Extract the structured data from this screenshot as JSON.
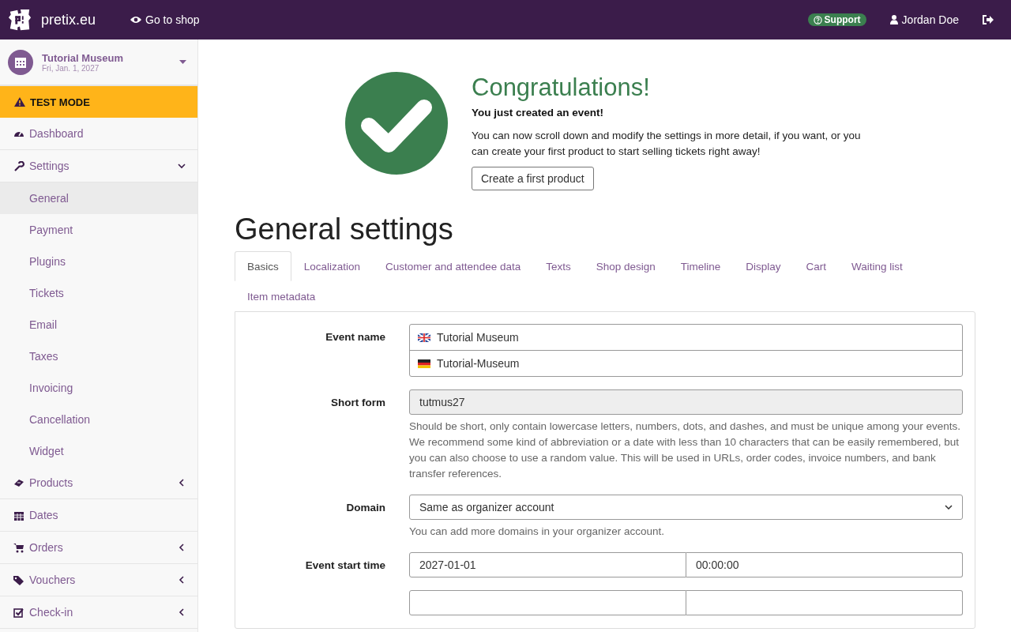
{
  "topbar": {
    "brand": "pretix.eu",
    "shop_link": "Go to shop",
    "support": "Support",
    "user": "Jordan Doe"
  },
  "sidebar": {
    "event": {
      "name": "Tutorial Museum",
      "date": "Fri, Jan. 1, 2027"
    },
    "test_mode": "TEST MODE",
    "items": [
      {
        "label": "Dashboard",
        "selected": false
      },
      {
        "label": "Settings",
        "selected": false,
        "expanded": true,
        "children": [
          {
            "label": "General",
            "selected": true
          },
          {
            "label": "Payment",
            "selected": false
          },
          {
            "label": "Plugins",
            "selected": false
          },
          {
            "label": "Tickets",
            "selected": false
          },
          {
            "label": "Email",
            "selected": false
          },
          {
            "label": "Taxes",
            "selected": false
          },
          {
            "label": "Invoicing",
            "selected": false
          },
          {
            "label": "Cancellation",
            "selected": false
          },
          {
            "label": "Widget",
            "selected": false
          }
        ]
      },
      {
        "label": "Products",
        "selected": false,
        "expanded": false
      },
      {
        "label": "Dates",
        "selected": false
      },
      {
        "label": "Orders",
        "selected": false,
        "expanded": false
      },
      {
        "label": "Vouchers",
        "selected": false,
        "expanded": false
      },
      {
        "label": "Check-in",
        "selected": false,
        "expanded": false
      }
    ]
  },
  "success": {
    "title": "Congratulations!",
    "subtitle": "You just created an event!",
    "text": "You can now scroll down and modify the settings in more detail, if you want, or you can create your first product to start selling tickets right away!",
    "button": "Create a first product"
  },
  "heading": "General settings",
  "tabs": [
    {
      "label": "Basics",
      "selected": true
    },
    {
      "label": "Localization",
      "selected": false
    },
    {
      "label": "Customer and attendee data",
      "selected": false
    },
    {
      "label": "Texts",
      "selected": false
    },
    {
      "label": "Shop design",
      "selected": false
    },
    {
      "label": "Timeline",
      "selected": false
    },
    {
      "label": "Display",
      "selected": false
    },
    {
      "label": "Cart",
      "selected": false
    },
    {
      "label": "Waiting list",
      "selected": false
    },
    {
      "label": "Item metadata",
      "selected": false
    }
  ],
  "fields": [
    {
      "kind": "i18n",
      "label": "Event name",
      "values": [
        "Tutorial Museum",
        "Tutorial-Museum"
      ]
    },
    {
      "kind": "text",
      "label": "Short form",
      "value": "tutmus27",
      "disabled": true,
      "help": "Should be short, only contain lowercase letters, numbers, dots, and dashes, and must be unique among your events. We recommend some kind of abbreviation or a date with less than 10 characters that can be easily remembered, but you can also choose to use a random value. This will be used in URLs, order codes, invoice numbers, and bank transfer references."
    },
    {
      "kind": "select",
      "label": "Domain",
      "value": "Same as organizer account",
      "help": "You can add more domains in your organizer account."
    },
    {
      "kind": "datetime",
      "label": "Event start time",
      "values": [
        "2027-01-01",
        "00:00:00"
      ]
    },
    {
      "kind": "datetime"
    }
  ]
}
